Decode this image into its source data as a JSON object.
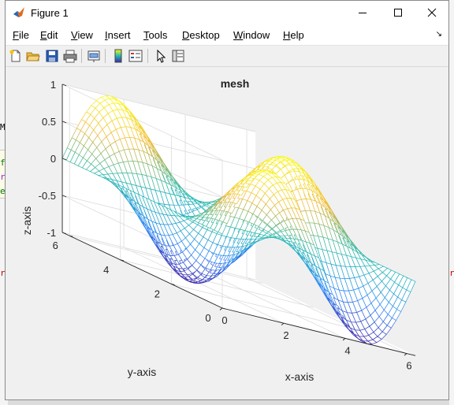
{
  "window": {
    "title": "Figure 1",
    "controls": {
      "minimize": "minimize-icon",
      "maximize": "maximize-icon",
      "close": "close-icon"
    }
  },
  "menubar": {
    "items": [
      {
        "label": "File",
        "accel": "F"
      },
      {
        "label": "Edit",
        "accel": "E"
      },
      {
        "label": "View",
        "accel": "V"
      },
      {
        "label": "Insert",
        "accel": "I"
      },
      {
        "label": "Tools",
        "accel": "T"
      },
      {
        "label": "Desktop",
        "accel": "D"
      },
      {
        "label": "Window",
        "accel": "W"
      },
      {
        "label": "Help",
        "accel": "H"
      }
    ]
  },
  "toolbar": {
    "buttons": [
      "new-figure-icon",
      "open-file-icon",
      "save-icon",
      "print-icon",
      "link-plot-icon",
      "insert-colorbar-icon",
      "insert-legend-icon",
      "edit-plot-icon",
      "property-inspector-icon"
    ]
  },
  "chart_data": {
    "type": "mesh",
    "title": "mesh",
    "xlabel": "x-axis",
    "ylabel": "y-axis",
    "zlabel": "z-axis",
    "function": "z = sin(x) * cos(y)",
    "x_range": [
      0,
      6.2832
    ],
    "y_range": [
      0,
      6.2832
    ],
    "zlim": [
      -1,
      1
    ],
    "x_ticks": [
      "0",
      "2",
      "4",
      "6"
    ],
    "y_ticks": [
      "0",
      "2",
      "4",
      "6"
    ],
    "z_ticks": [
      "-1",
      "-0.5",
      "0",
      "0.5",
      "1"
    ],
    "colormap": "parula",
    "grid": true,
    "mesh_samples": 41,
    "colors": {
      "low": "#3e26a8",
      "mid": "#23b8b0",
      "high": "#f9fb14"
    }
  },
  "background_editor": {
    "lines": [
      "M",
      "fi",
      "ra",
      "e",
      "r",
      "r"
    ]
  }
}
